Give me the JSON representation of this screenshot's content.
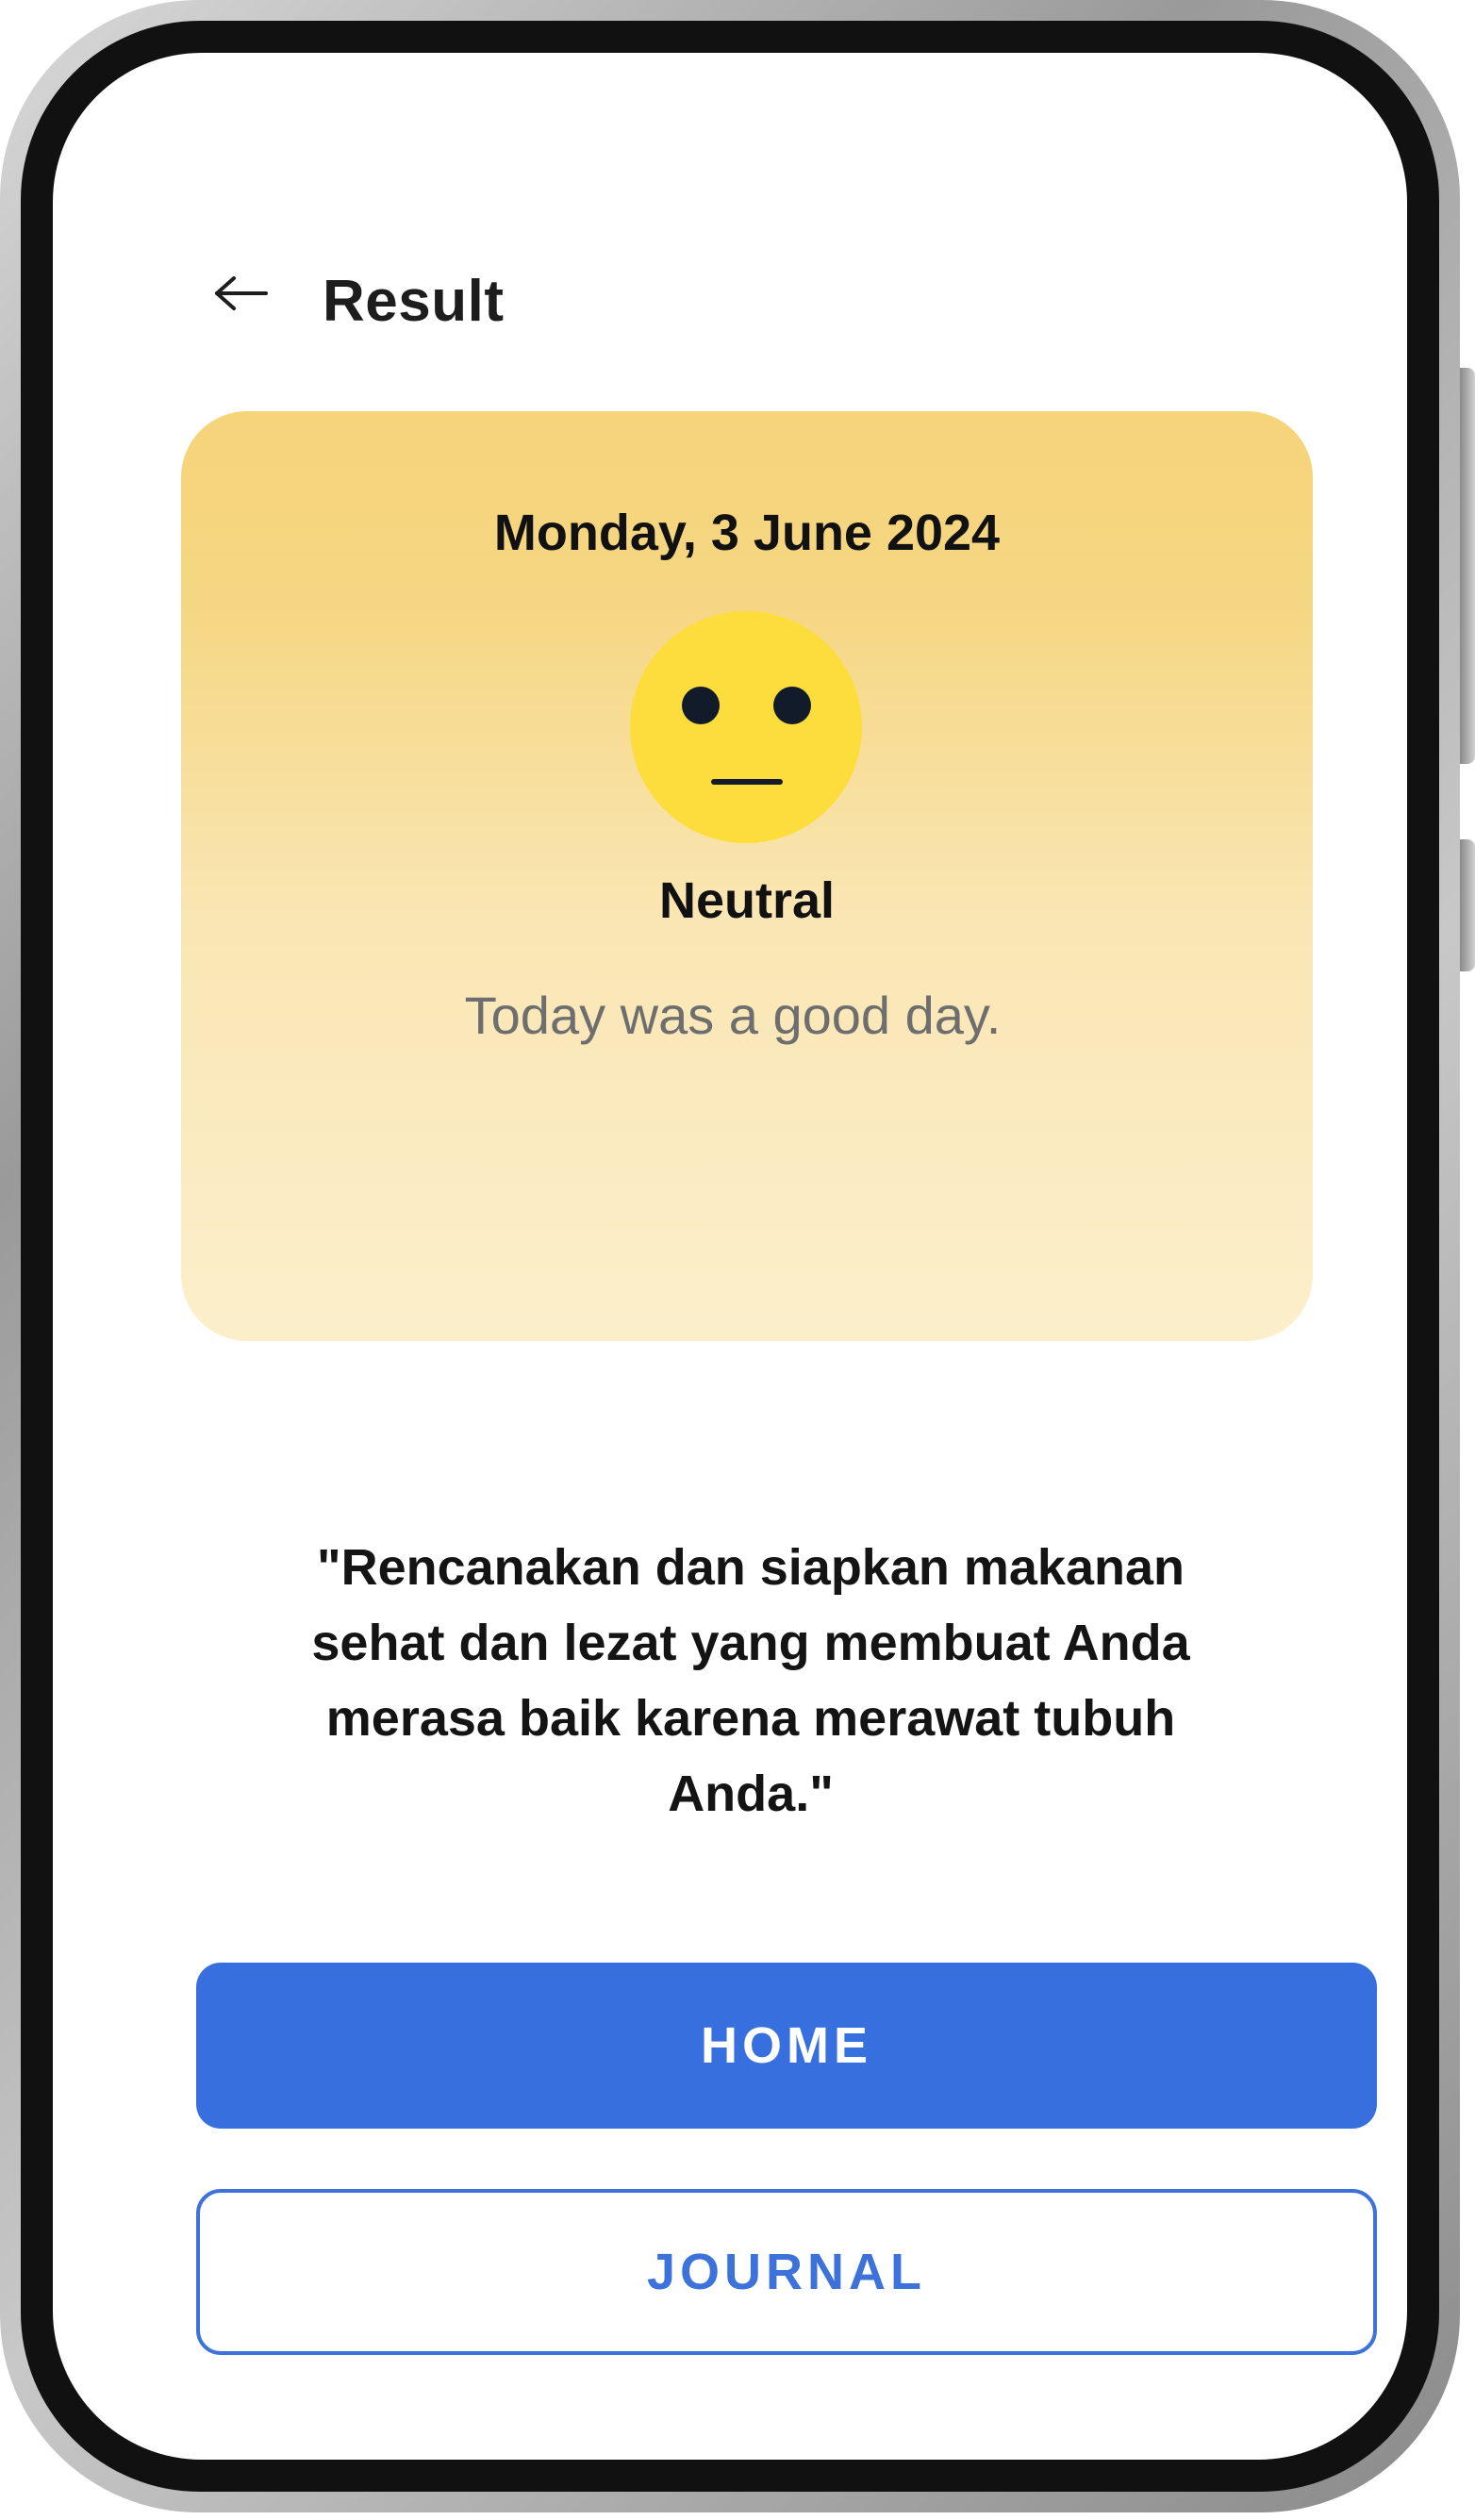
{
  "header": {
    "back_icon": "arrow-left-icon",
    "title": "Result"
  },
  "mood_card": {
    "date": "Monday, 3 June 2024",
    "emoji_icon": "neutral-face-icon",
    "mood": "Neutral",
    "note": "Today was a good day.",
    "gradient_top": "#f6d47a",
    "gradient_bottom": "#fbefcb",
    "emoji_color": "#fddd3c"
  },
  "quote": {
    "text": "\"Rencanakan dan siapkan makanan sehat dan lezat yang membuat Anda merasa baik karena merawat tubuh Anda.\""
  },
  "actions": {
    "home_label": "HOME",
    "journal_label": "JOURNAL",
    "primary_color": "#386fde"
  }
}
